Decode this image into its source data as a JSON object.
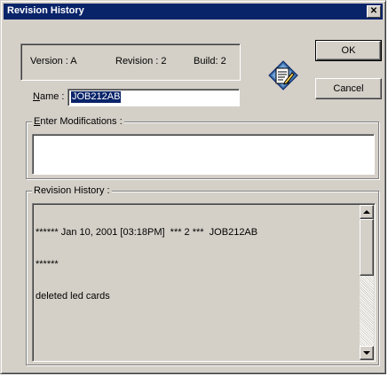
{
  "window": {
    "title": "Revision History",
    "close_glyph": "✕"
  },
  "info": {
    "version_label": "Version :  A",
    "revision_label": "Revision :  2",
    "build_label": "Build:  2"
  },
  "buttons": {
    "ok_label": "OK",
    "cancel_label": "Cancel"
  },
  "name_field": {
    "label_mnemonic": "N",
    "label_rest": "ame :",
    "value": "JOB212AB"
  },
  "modifications": {
    "label_mnemonic": "E",
    "label_rest": "nter Modifications :",
    "value": ""
  },
  "history": {
    "label": "Revision History :",
    "lines": [
      "****** Jan 10, 2001 [03:18PM]  *** 2 ***  JOB212AB",
      "******",
      "deleted led cards"
    ]
  },
  "icons": {
    "edit_document": "document-edit-icon",
    "scroll_up": "arrow-up-icon",
    "scroll_down": "arrow-down-icon"
  },
  "colors": {
    "titlebar": "#0a246a",
    "dialog_bg": "#d4d0c8",
    "selection": "#0a246a"
  }
}
